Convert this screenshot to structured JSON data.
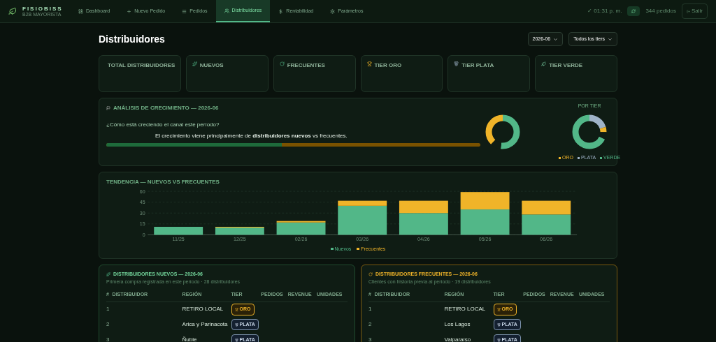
{
  "brand": {
    "name": "FISIOBISS",
    "tagline": "B2B MAYORISTA"
  },
  "nav": [
    {
      "kind": "dashboard",
      "label": "Dashboard",
      "selected": false
    },
    {
      "kind": "nuevo",
      "label": "Nuevo Pedido",
      "selected": false
    },
    {
      "kind": "pedidos",
      "label": "Pedidos",
      "selected": false
    },
    {
      "kind": "distribuidores",
      "label": "Distribuidores",
      "selected": true
    },
    {
      "kind": "rentabilidad",
      "label": "Rentabilidad",
      "selected": false
    },
    {
      "kind": "parametros",
      "label": "Parámetros",
      "selected": false
    }
  ],
  "status": {
    "sync": "✓ 01:31 p. m.",
    "orders": "344 pedidos",
    "logout": "Salir"
  },
  "page_title": "Distribuidores",
  "filters": [
    {
      "value": "2026-06"
    },
    {
      "value": "Todos los tiers"
    }
  ],
  "kpis": [
    {
      "kind": "total",
      "label": "TOTAL DISTRIBUIDORES"
    },
    {
      "kind": "nuevos",
      "label": "NUEVOS"
    },
    {
      "kind": "frecuentes",
      "label": "FRECUENTES"
    },
    {
      "kind": "oro",
      "label": "TIER ORO"
    },
    {
      "kind": "plata",
      "label": "TIER PLATA"
    },
    {
      "kind": "verde",
      "label": "TIER VERDE"
    }
  ],
  "analysis": {
    "title": "ANÁLISIS DE CRECIMIENTO — 2026-06",
    "question": "¿Cómo está creciendo el canal este período?",
    "summary": "El crecimiento viene principalmente de **distribuidores nuevos** vs frecuentes.",
    "level": 0.47,
    "tier_caption": "POR TIER",
    "tier_legend": [
      {
        "label": "ORO",
        "color": "#f0b429"
      },
      {
        "label": "PLATA",
        "color": "#9fb3c8"
      },
      {
        "label": "VERDE",
        "color": "#52b788"
      }
    ]
  },
  "trend": {
    "title": "TENDENCIA — NUEVOS VS FRECUENTES",
    "chart_data": {
      "type": "bar",
      "stacked": true,
      "categories": [
        "11/25",
        "12/25",
        "02/26",
        "03/26",
        "04/26",
        "05/26",
        "06/26"
      ],
      "series": [
        {
          "name": "Nuevos",
          "color": "#52b788",
          "values": [
            11,
            10,
            17,
            40,
            30,
            35,
            28
          ]
        },
        {
          "name": "Frecuentes",
          "color": "#f0b429",
          "values": [
            0,
            1,
            2,
            7,
            17,
            24,
            19
          ]
        }
      ],
      "ylim": [
        0,
        60
      ],
      "yticks": [
        0,
        15,
        30,
        45,
        60
      ],
      "grid": true
    }
  },
  "tables": [
    {
      "kind": "nuevos",
      "title": "DISTRIBUIDORES NUEVOS — 2026-06",
      "subtitle": "Primera compra registrada en este período · 28 distribuidores",
      "columns": [
        "#",
        "DISTRIBUIDOR",
        "REGIÓN",
        "TIER",
        "PEDIDOS",
        "REVENUE",
        "UNIDADES"
      ],
      "rows": [
        {
          "n": "1",
          "region": "RETIRO LOCAL",
          "tier": {
            "kind": "oro",
            "label": "ORO"
          }
        },
        {
          "n": "2",
          "region": "Arica y Parinacota",
          "tier": {
            "kind": "plata",
            "label": "PLATA"
          }
        },
        {
          "n": "3",
          "region": "Ñuble",
          "tier": {
            "kind": "plata",
            "label": "PLATA"
          }
        }
      ]
    },
    {
      "kind": "frecuentes",
      "title": "DISTRIBUIDORES FRECUENTES — 2026-06",
      "subtitle": "Clientes con historia previa al período · 19 distribuidores",
      "columns": [
        "#",
        "DISTRIBUIDOR",
        "REGIÓN",
        "TIER",
        "PEDIDOS",
        "REVENUE",
        "UNIDADES"
      ],
      "rows": [
        {
          "n": "1",
          "region": "RETIRO LOCAL",
          "tier": {
            "kind": "oro",
            "label": "ORO"
          }
        },
        {
          "n": "2",
          "region": "Los Lagos",
          "tier": {
            "kind": "plata",
            "label": "PLATA"
          }
        },
        {
          "n": "3",
          "region": "Valparaíso",
          "tier": {
            "kind": "plata",
            "label": "PLATA"
          }
        }
      ]
    }
  ]
}
